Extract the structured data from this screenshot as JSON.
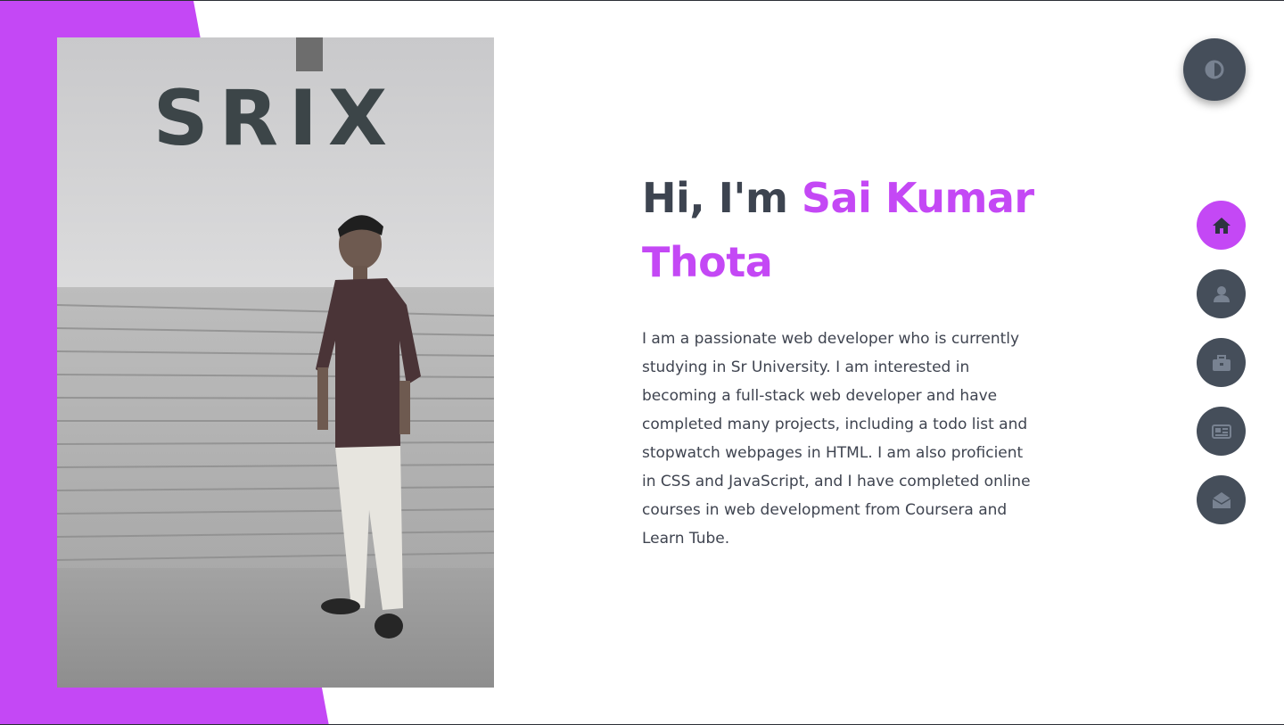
{
  "hero": {
    "greeting": "Hi, I'm ",
    "name_line1": "Sai Kumar",
    "name_line2": "Thota",
    "description": "I am a passionate web developer who is currently studying in Sr University. I am interested in becoming a full-stack web developer and have completed many projects, including a todo list and stopwatch webpages in HTML. I am also proficient in CSS and JavaScript, and I have completed online courses in web development from Coursera and Learn Tube."
  },
  "photo": {
    "sign_text": "SRIX"
  },
  "theme_toggle": {
    "icon": "contrast-icon"
  },
  "nav": {
    "items": [
      {
        "icon": "home-icon",
        "active": true
      },
      {
        "icon": "user-icon",
        "active": false
      },
      {
        "icon": "briefcase-icon",
        "active": false
      },
      {
        "icon": "newspaper-icon",
        "active": false
      },
      {
        "icon": "envelope-open-icon",
        "active": false
      }
    ]
  },
  "colors": {
    "accent": "#c448f5",
    "dark": "#454e5a",
    "text": "#3f4450",
    "background": "#ffffff"
  }
}
